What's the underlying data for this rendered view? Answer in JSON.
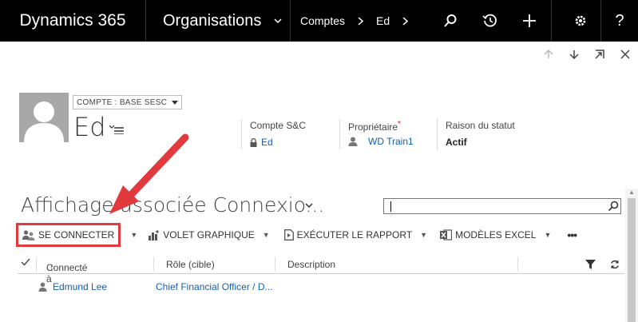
{
  "topbar": {
    "brand": "Dynamics 365",
    "area": "Organisations",
    "breadcrumb": [
      "Comptes",
      "Ed"
    ],
    "icons": [
      "search-icon",
      "history-icon",
      "add-icon",
      "settings-icon",
      "help-icon"
    ]
  },
  "record": {
    "form_selector": "COMPTE : BASE SESC",
    "name": "Ed",
    "fields": [
      {
        "label": "Compte S&C",
        "value": "Ed",
        "required": false
      },
      {
        "label": "Propriétaire",
        "value": "WD Train1",
        "required": true
      },
      {
        "label": "Raison du statut",
        "value": "Actif",
        "required": false
      }
    ]
  },
  "view": {
    "title": "Affichage associée Connexio...",
    "search_value": ""
  },
  "commands": [
    {
      "label": "SE CONNECTER",
      "icon": "connect-icon",
      "highlighted": true
    },
    {
      "label": "VOLET GRAPHIQUE",
      "icon": "chart-pane-icon"
    },
    {
      "label": "EXÉCUTER LE RAPPORT",
      "icon": "report-icon"
    },
    {
      "label": "MODÈLES EXCEL",
      "icon": "excel-icon"
    },
    {
      "label": "•••",
      "icon": "more-icon"
    }
  ],
  "grid": {
    "columns": [
      "Connecté à",
      "Rôle (cible)",
      "Description"
    ],
    "sort_column": "Connecté à",
    "rows": [
      {
        "connected_to": "Edmund Lee",
        "role": "Chief Financial Officer / D...",
        "description": ""
      }
    ]
  },
  "colors": {
    "topbar": "#000000",
    "link": "#1160b7",
    "highlight": "#e0393e",
    "required": "#e81123"
  }
}
